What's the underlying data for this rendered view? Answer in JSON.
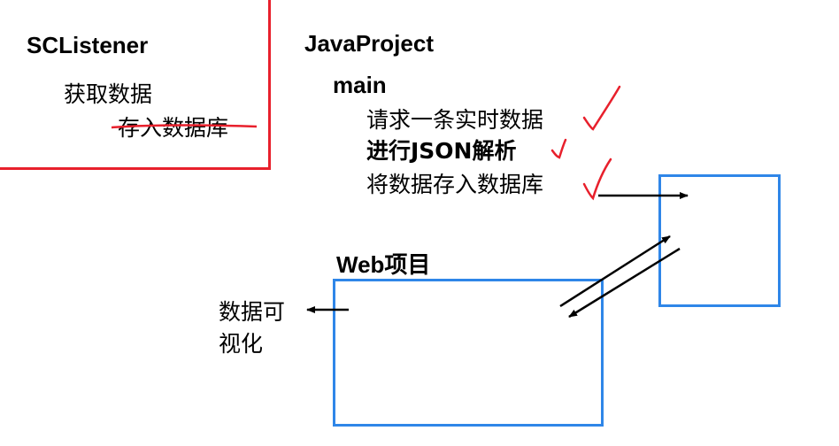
{
  "left_panel": {
    "title": "SCListener",
    "step1": "获取数据",
    "step2": "存入数据库"
  },
  "java_project": {
    "title": "JavaProject",
    "main": "main",
    "steps": [
      "请求一条实时数据",
      "进行JSON解析",
      "将数据存入数据库"
    ]
  },
  "web_project": {
    "title": "Web项目"
  },
  "visualization": {
    "line1": "数据可",
    "line2": "视化"
  },
  "colors": {
    "red": "#e8202c",
    "blue": "#2f86e8",
    "text": "#000000"
  }
}
